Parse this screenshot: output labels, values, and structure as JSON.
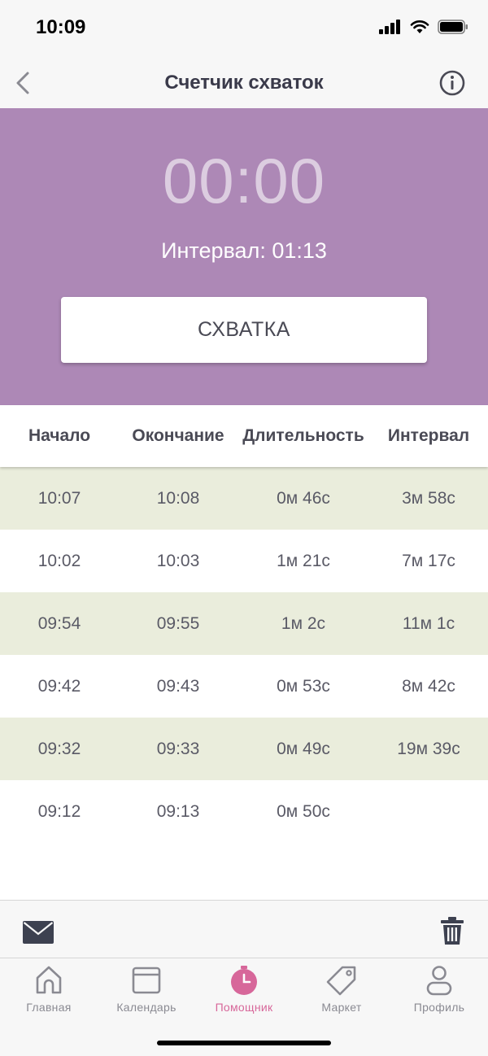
{
  "status_bar": {
    "time": "10:09"
  },
  "nav": {
    "title": "Счетчик схваток",
    "back_icon": "chevron-left-icon",
    "info_icon": "info-icon"
  },
  "timer": {
    "value": "00:00",
    "interval_text": "Интервал: 01:13",
    "button_label": "СХВАТКА",
    "panel_color": "#ad88b6"
  },
  "table": {
    "headers": [
      "Начало",
      "Окончание",
      "Длительность",
      "Интервал"
    ],
    "rows": [
      {
        "start": "10:07",
        "end": "10:08",
        "duration": "0м 46с",
        "interval": "3м 58с"
      },
      {
        "start": "10:02",
        "end": "10:03",
        "duration": "1м 21с",
        "interval": "7м 17с"
      },
      {
        "start": "09:54",
        "end": "09:55",
        "duration": "1м 2с",
        "interval": "11м 1с"
      },
      {
        "start": "09:42",
        "end": "09:43",
        "duration": "0м 53с",
        "interval": "8м 42с"
      },
      {
        "start": "09:32",
        "end": "09:33",
        "duration": "0м 49с",
        "interval": "19м 39с"
      },
      {
        "start": "09:12",
        "end": "09:13",
        "duration": "0м 50с",
        "interval": ""
      }
    ]
  },
  "actions": {
    "mail_icon": "mail-icon",
    "trash_icon": "trash-icon"
  },
  "tabs": [
    {
      "label": "Главная",
      "icon": "home-icon",
      "active": false
    },
    {
      "label": "Календарь",
      "icon": "calendar-icon",
      "active": false
    },
    {
      "label": "Помощник",
      "icon": "timer-icon",
      "active": true
    },
    {
      "label": "Маркет",
      "icon": "tag-icon",
      "active": false
    },
    {
      "label": "Профиль",
      "icon": "profile-icon",
      "active": false
    }
  ],
  "colors": {
    "accent": "#d7679a",
    "row_shade": "#eaeddc"
  }
}
